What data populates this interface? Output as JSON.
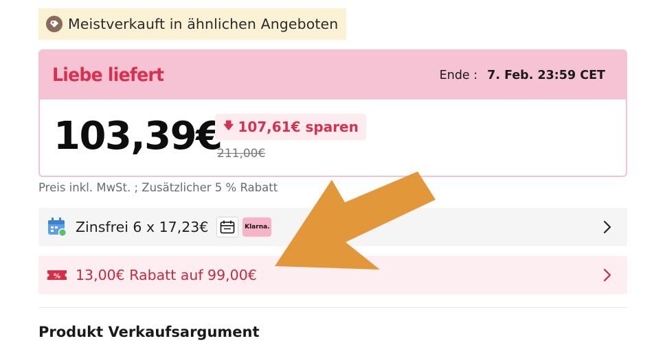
{
  "badge": {
    "text": "Meistverkauft in ähnlichen Angeboten",
    "icon": "tag-icon"
  },
  "deal": {
    "title": "Liebe liefert",
    "end_label": "Ende :",
    "end_value": "7. Feb. 23:59 CET",
    "price": "103,39€",
    "savings": "107,61€ sparen",
    "original_price": "211,00€"
  },
  "tax_note": "Preis inkl. MwSt. ; Zusätzlicher 5 % Rabatt",
  "installment": {
    "text": "Zinsfrei 6 x 17,23€",
    "klarna": "Klarna."
  },
  "coupon": {
    "text": "13,00€ Rabatt auf 99,00€"
  },
  "section_title": "Produkt Verkaufsargument",
  "colors": {
    "brand_red": "#d9304f",
    "header_pink": "#f5c3d3",
    "badge_bg": "#fbf2d6",
    "annotation_arrow": "#e0922f"
  }
}
